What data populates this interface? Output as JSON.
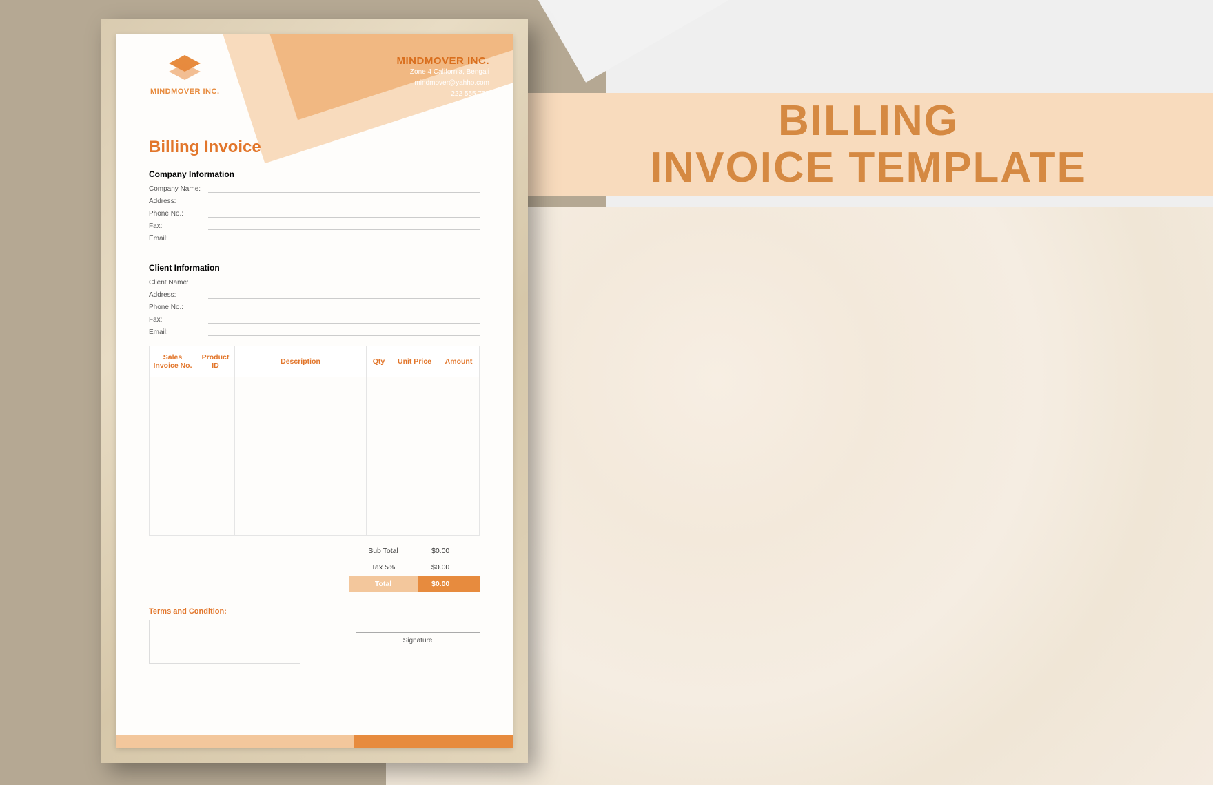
{
  "banner": {
    "line1": "BILLING",
    "line2": "INVOICE TEMPLATE"
  },
  "logo_text": "MINDMOVER INC.",
  "biz": {
    "name": "MINDMOVER INC.",
    "addr": "Zone 4 California, Bengali",
    "email": "mindmover@yahho.com",
    "phone": "222 555 777"
  },
  "doc_title": "Billing Invoice",
  "company_section": "Company Information",
  "client_section": "Client Information",
  "fields": {
    "company_name": "Company Name:",
    "address": "Address:",
    "phone": "Phone No.:",
    "fax": "Fax:",
    "email": "Email:",
    "client_name": "Client Name:"
  },
  "table": {
    "h1": "Sales Invoice No.",
    "h2": "Product ID",
    "h3": "Description",
    "h4": "Qty",
    "h5": "Unit Price",
    "h6": "Amount"
  },
  "totals": {
    "sub_label": "Sub Total",
    "sub_val": "$0.00",
    "tax_label": "Tax 5%",
    "tax_val": "$0.00",
    "tot_label": "Total",
    "tot_val": "$0.00"
  },
  "terms_label": "Terms and Condition:",
  "signature_label": "Signature"
}
